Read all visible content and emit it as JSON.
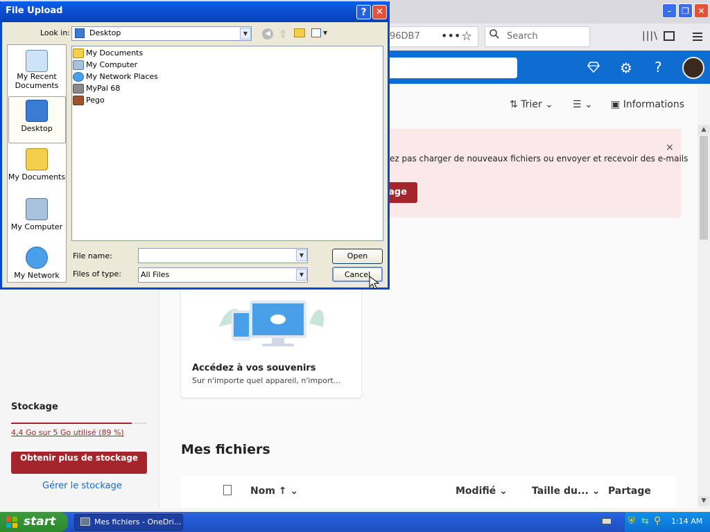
{
  "browser": {
    "url_fragment": "96DB7",
    "url_more": "•••",
    "search_placeholder": "Search"
  },
  "onedrive": {
    "commands": {
      "sort_label": "Trier",
      "info_label": "Informations"
    },
    "banner": {
      "message": "ez pas charger de nouveaux fichiers ou envoyer et recevoir des e-mails",
      "button_label": "age",
      "close": "×"
    },
    "card": {
      "title": "Accédez à vos souvenirs",
      "description": "Sur n'importe quel appareil, n'import..."
    },
    "storage": {
      "heading": "Stockage",
      "usage_text": "4,4 Go sur 5 Go utilisé (89 %)",
      "used_fraction": 0.89,
      "get_more_label": "Obtenir plus de stockage",
      "manage_label": "Gérer le stockage"
    },
    "files": {
      "heading": "Mes fichiers",
      "columns": {
        "name": "Nom ↑",
        "modified": "Modifié",
        "size": "Taille du...",
        "sharing": "Partage"
      }
    }
  },
  "dialog": {
    "title": "File Upload",
    "help": "?",
    "close": "✕",
    "look_in_label": "Look in:",
    "look_in_value": "Desktop",
    "places": [
      {
        "label": "My Recent Documents"
      },
      {
        "label": "Desktop"
      },
      {
        "label": "My Documents"
      },
      {
        "label": "My Computer"
      },
      {
        "label": "My Network"
      }
    ],
    "files": [
      {
        "name": "My Documents"
      },
      {
        "name": "My Computer"
      },
      {
        "name": "My Network Places"
      },
      {
        "name": "MyPal 68"
      },
      {
        "name": "Pego"
      }
    ],
    "file_name_label": "File name:",
    "file_name_value": "",
    "files_of_type_label": "Files of type:",
    "files_of_type_value": "All Files",
    "open_label": "Open",
    "cancel_label": "Cancel"
  },
  "taskbar": {
    "start_label": "start",
    "task_label": "Mes fichiers - OneDri...",
    "clock": "1:14 AM"
  },
  "colors": {
    "onedrive_blue": "#0f6cd1",
    "storage_red": "#a4262c",
    "xp_title_blue": "#0a5fe6"
  }
}
